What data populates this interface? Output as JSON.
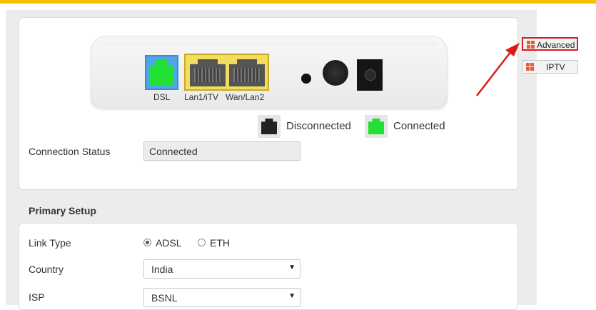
{
  "router": {
    "ports": {
      "dsl": "DSL",
      "lan1": "Lan1/iTV",
      "wan": "Wan/Lan2"
    }
  },
  "legend": {
    "disconnected": "Disconnected",
    "connected": "Connected"
  },
  "connection_status": {
    "label": "Connection Status",
    "value": "Connected"
  },
  "primary_setup": {
    "title": "Primary Setup",
    "link_type": {
      "label": "Link Type",
      "options": [
        "ADSL",
        "ETH"
      ],
      "selected": "ADSL"
    },
    "country": {
      "label": "Country",
      "value": "India"
    },
    "isp": {
      "label": "ISP",
      "value": "BSNL"
    }
  },
  "side_buttons": {
    "advanced": "Advanced",
    "iptv": "IPTV"
  },
  "colors": {
    "accent_bar": "#f5c400",
    "connected": "#22e034",
    "highlight": "#d42020"
  }
}
